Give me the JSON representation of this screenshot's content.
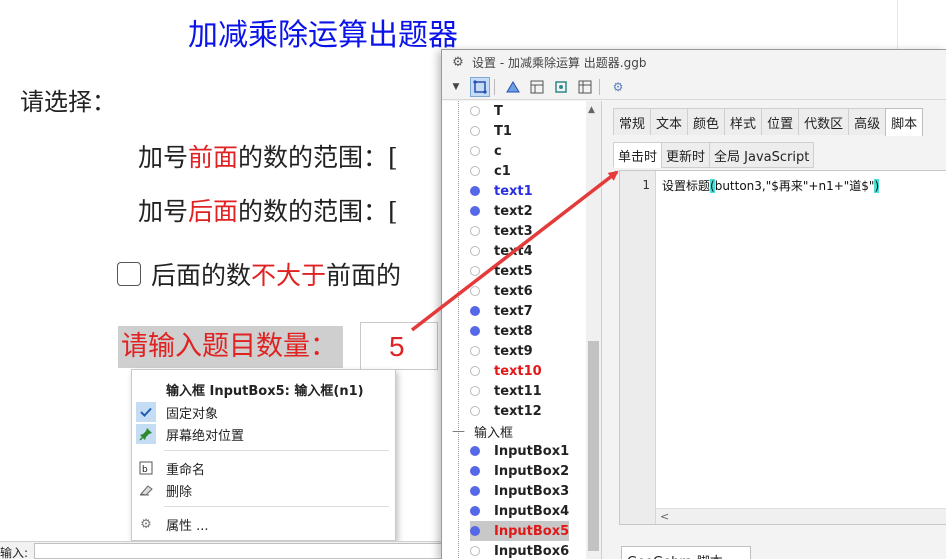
{
  "graphics": {
    "title": "加减乘除运算出题器",
    "prompt": "请选择：",
    "line1": {
      "pre": "加号",
      "red": "前面",
      "post": "的数的范围：",
      "tail": "[ "
    },
    "line2": {
      "pre": "加号",
      "red": "后面",
      "post": "的数的范围：",
      "tail": "[ "
    },
    "line3": {
      "pre": "后面的数",
      "red": "不大于",
      "post": "前面的"
    },
    "count_label": "请输入题目数量：",
    "count_value": "5"
  },
  "context_menu": {
    "header": "输入框 InputBox5: 输入框(n1)",
    "items": [
      {
        "label": "固定对象",
        "icon": "check-icon"
      },
      {
        "label": "屏幕绝对位置",
        "icon": "pin-icon"
      },
      {
        "label": "重命名",
        "icon": "rename-icon"
      },
      {
        "label": "删除",
        "icon": "eraser-icon"
      },
      {
        "label": "属性 ...",
        "icon": "gear-icon"
      }
    ]
  },
  "input_bar": {
    "label": "输入:"
  },
  "settings": {
    "title": "设置 - 加减乘除运算 出题器.ggb",
    "objects": [
      {
        "name": "T",
        "dot": "empty",
        "color": "black"
      },
      {
        "name": "T1",
        "dot": "empty",
        "color": "black"
      },
      {
        "name": "c",
        "dot": "empty",
        "color": "black"
      },
      {
        "name": "c1",
        "dot": "empty",
        "color": "black"
      },
      {
        "name": "text1",
        "dot": "filled",
        "color": "blue"
      },
      {
        "name": "text2",
        "dot": "filled",
        "color": "black"
      },
      {
        "name": "text3",
        "dot": "empty",
        "color": "black"
      },
      {
        "name": "text4",
        "dot": "empty",
        "color": "black"
      },
      {
        "name": "text5",
        "dot": "empty",
        "color": "black"
      },
      {
        "name": "text6",
        "dot": "empty",
        "color": "black"
      },
      {
        "name": "text7",
        "dot": "filled",
        "color": "black"
      },
      {
        "name": "text8",
        "dot": "filled",
        "color": "black"
      },
      {
        "name": "text9",
        "dot": "empty",
        "color": "black"
      },
      {
        "name": "text10",
        "dot": "empty",
        "color": "red"
      },
      {
        "name": "text11",
        "dot": "empty",
        "color": "black"
      },
      {
        "name": "text12",
        "dot": "empty",
        "color": "black"
      }
    ],
    "group_label": "输入框",
    "inputboxes": [
      {
        "name": "InputBox1",
        "dot": "filled",
        "color": "black"
      },
      {
        "name": "InputBox2",
        "dot": "filled",
        "color": "black"
      },
      {
        "name": "InputBox3",
        "dot": "filled",
        "color": "black"
      },
      {
        "name": "InputBox4",
        "dot": "filled",
        "color": "black"
      },
      {
        "name": "InputBox5",
        "dot": "filled",
        "color": "red",
        "selected": true
      },
      {
        "name": "InputBox6",
        "dot": "empty",
        "color": "black"
      }
    ],
    "tabs": [
      "常规",
      "文本",
      "颜色",
      "样式",
      "位置",
      "代数区",
      "高级",
      "脚本"
    ],
    "active_tab": "脚本",
    "subtabs": [
      "单击时",
      "更新时",
      "全局 JavaScript"
    ],
    "active_subtab": "单击时",
    "script_line_no": "1",
    "script_code": {
      "pre": "设置标题",
      "open": "(",
      "mid": "button3,\"$再来\"+n1+\"道$\"",
      "close": ")"
    },
    "script_language": "GeoGebra 脚本",
    "colors": {
      "accent": "#2a2fe0",
      "red": "#e01818",
      "title_blue": "#0b14e8",
      "arrow_red": "#e43a3a"
    }
  }
}
